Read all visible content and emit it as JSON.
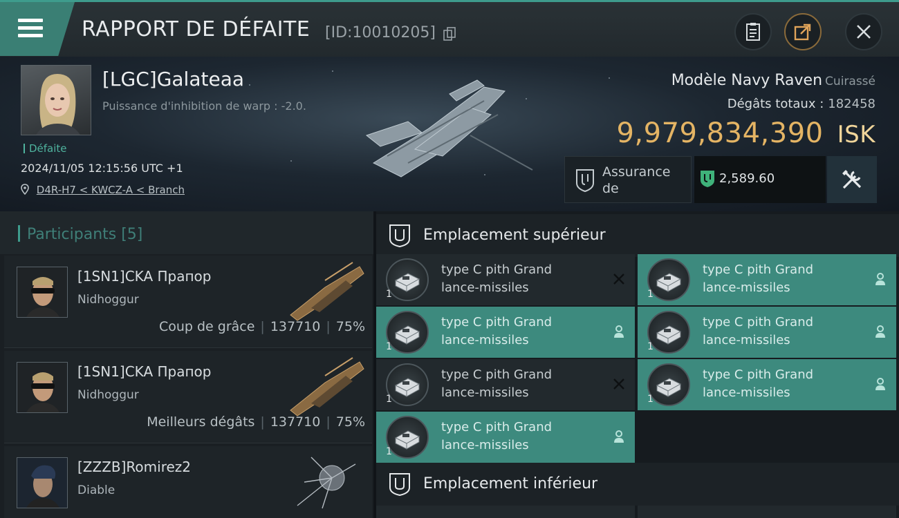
{
  "header": {
    "title": "RAPPORT DE DÉFAITE",
    "id_text": "[ID:10010205]",
    "icons": [
      "menu-icon",
      "copy-icon",
      "clipboard-icon",
      "share-icon",
      "close-icon"
    ]
  },
  "victim": {
    "name": "[LGC]Galateaa",
    "subtitle": "Puissance d'inhibition de warp : -2.0.",
    "status": "Défaite",
    "datetime": "2024/11/05 12:15:56 UTC +1",
    "location": "D4R-H7 < KWCZ-A < Branch",
    "ship_model": "Modèle Navy Raven",
    "ship_class": "Cuirassé",
    "damage_label": "Dégâts totaux :",
    "damage_value": "182458",
    "isk_value": "9,979,834,390",
    "isk_unit": "ISK",
    "insurance_label": "Assurance de",
    "insurance_value": "2,589.60"
  },
  "participants": {
    "title": "Participants [5]",
    "items": [
      {
        "name": "[1SN1]CKA Прапор",
        "ship": "Nidhoggur",
        "role": "Coup de grâce",
        "damage": "137710",
        "percent": "75%"
      },
      {
        "name": "[1SN1]CKA Прапор",
        "ship": "Nidhoggur",
        "role": "Meilleurs dégâts",
        "damage": "137710",
        "percent": "75%"
      },
      {
        "name": "[ZZZB]Romirez2",
        "ship": "Diable",
        "role": "",
        "damage": "",
        "percent": ""
      }
    ]
  },
  "slots": {
    "high_title": "Emplacement supérieur",
    "low_title": "Emplacement inférieur",
    "items": [
      {
        "name_line1": "type C pith Grand",
        "name_line2": "lance-missiles",
        "qty": "1",
        "state": "destroyed"
      },
      {
        "name_line1": "type C pith Grand",
        "name_line2": "lance-missiles",
        "qty": "1",
        "state": "dropped"
      },
      {
        "name_line1": "type C pith Grand",
        "name_line2": "lance-missiles",
        "qty": "1",
        "state": "dropped"
      },
      {
        "name_line1": "type C pith Grand",
        "name_line2": "lance-missiles",
        "qty": "1",
        "state": "dropped"
      },
      {
        "name_line1": "type C pith Grand",
        "name_line2": "lance-missiles",
        "qty": "1",
        "state": "destroyed"
      },
      {
        "name_line1": "type C pith Grand",
        "name_line2": "lance-missiles",
        "qty": "1",
        "state": "dropped"
      },
      {
        "name_line1": "type C pith Grand",
        "name_line2": "lance-missiles",
        "qty": "1",
        "state": "dropped"
      }
    ]
  },
  "colors": {
    "accent": "#3e9c8d",
    "isk": "#e4b464",
    "slot_on": "#3d8a7e"
  }
}
